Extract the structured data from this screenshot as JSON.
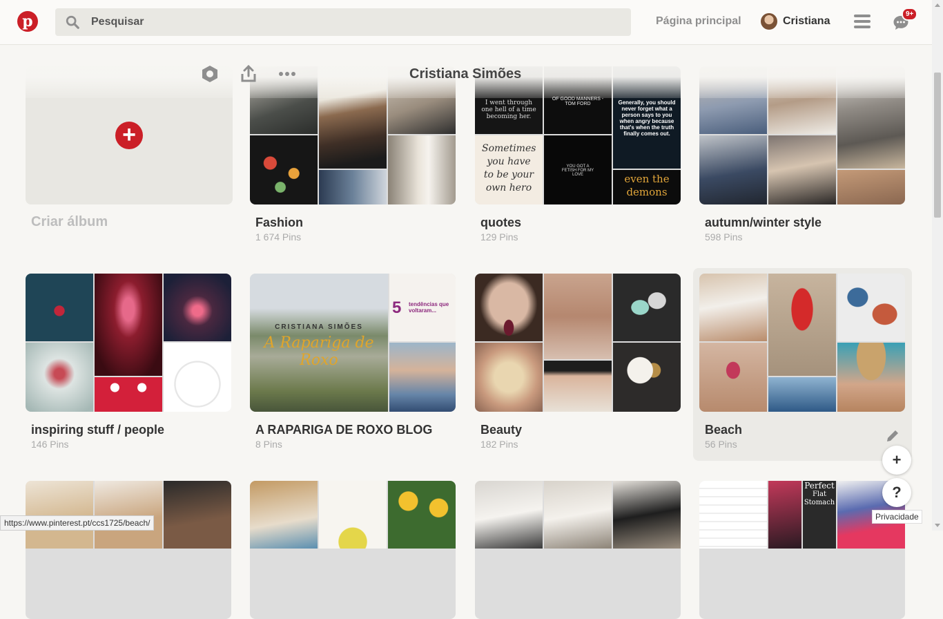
{
  "header": {
    "logo_letter": "p",
    "search_placeholder": "Pesquisar",
    "home_label": "Página principal",
    "user_name": "Cristiana",
    "messages_badge": "9+"
  },
  "profile": {
    "name": "Cristiana Simões"
  },
  "create_album": {
    "label": "Criar álbum"
  },
  "boards": [
    {
      "title": "Fashion",
      "count": "1 674 Pins"
    },
    {
      "title": "quotes",
      "count": "129 Pins"
    },
    {
      "title": "autumn/winter style",
      "count": "598 Pins"
    },
    {
      "title": "inspiring stuff / people",
      "count": "146 Pins"
    },
    {
      "title": "A RAPARIGA DE ROXO BLOG",
      "count": "8 Pins"
    },
    {
      "title": "Beauty",
      "count": "182 Pins"
    },
    {
      "title": "Beach",
      "count": "56 Pins"
    }
  ],
  "quote_tiles": {
    "q1": "I went through one hell of a time becoming her.",
    "q2": "OF GOOD MANNERS - TOM FORD",
    "q3": "Generally, you should never forget what a person says to you when angry because that's when the truth finally comes out.",
    "q4": "Sometimes you have to be your own hero",
    "q5": "YOU GOT A FETISH FOR MY LOVE",
    "q6": "even the demons"
  },
  "blog_tiles": {
    "brand": "CRISTIANA SIMÕES",
    "script": "A Rapariga de Roxo",
    "number": "5",
    "promo": "tendências que voltaram..."
  },
  "fitness_tile": {
    "line1": "Perfect",
    "line2": "Flat",
    "line3": "Stomach"
  },
  "floating": {
    "add_label": "+",
    "help_label": "?",
    "privacy_label": "Privacidade"
  },
  "status_url": "https://www.pinterest.pt/ccs1725/beach/",
  "colors": {
    "brand_red": "#cb1f27",
    "background": "#f7f6f3"
  }
}
